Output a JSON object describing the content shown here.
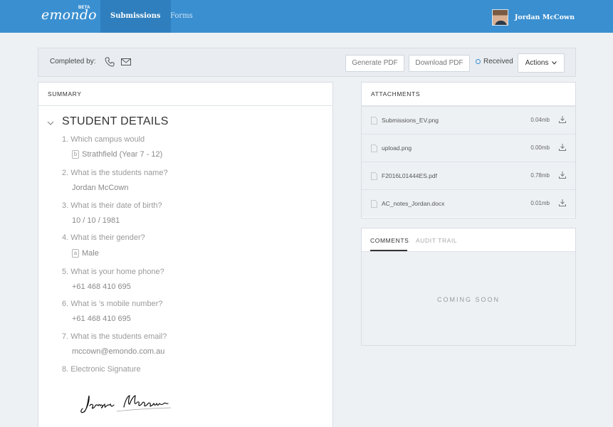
{
  "nav": {
    "logo": "emondo",
    "beta": "BETA",
    "tabs": [
      {
        "label": "Submissions"
      },
      {
        "label": "Forms"
      }
    ],
    "user_name": "Jordan McCown"
  },
  "toolbar": {
    "completed_by": "Completed by:",
    "generate_pdf": "Generate PDF",
    "download_pdf": "Download PDF",
    "status": "Received",
    "actions": "Actions"
  },
  "summary": {
    "heading": "SUMMARY",
    "section_title": "STUDENT DETAILS",
    "questions": [
      {
        "q": "1. Which campus would",
        "a": "Strathfield (Year 7 - 12)",
        "letter": "b"
      },
      {
        "q": "2. What is the students name?",
        "a": "Jordan McCown"
      },
      {
        "q": "3. What is their date of birth?",
        "a": "10 / 10 / 1981"
      },
      {
        "q": "4. What is their gender?",
        "a": "Male",
        "letter": "a"
      },
      {
        "q": "5. What is your home phone?",
        "a": "+61 468 410 695"
      },
      {
        "q": "6. What is 's mobile number?",
        "a": "+61 468 410 695"
      },
      {
        "q": "7. What is the students email?",
        "a": "mccown@emondo.com.au"
      },
      {
        "q": "8.  Electronic Signature"
      }
    ]
  },
  "attachments": {
    "heading": "ATTACHMENTS",
    "files": [
      {
        "name": "Submissions_EV.png",
        "size": "0.04mb"
      },
      {
        "name": "upload.png",
        "size": "0.00mb"
      },
      {
        "name": "F2016L01444ES.pdf",
        "size": "0.78mb"
      },
      {
        "name": "AC_notes_Jordan.docx",
        "size": "0.01mb"
      }
    ]
  },
  "comments": {
    "tabs": [
      {
        "label": "COMMENTS"
      },
      {
        "label": "AUDIT TRAIL"
      }
    ],
    "placeholder": "COMING SOON"
  },
  "colors": {
    "brand": "#3a8fd0",
    "nav_active": "#2f7fbe",
    "page_bg": "#eef1f4"
  },
  "icons": [
    "phone-icon",
    "mail-icon",
    "chevron-down-icon",
    "file-icon",
    "download-icon",
    "status-dot-icon"
  ]
}
